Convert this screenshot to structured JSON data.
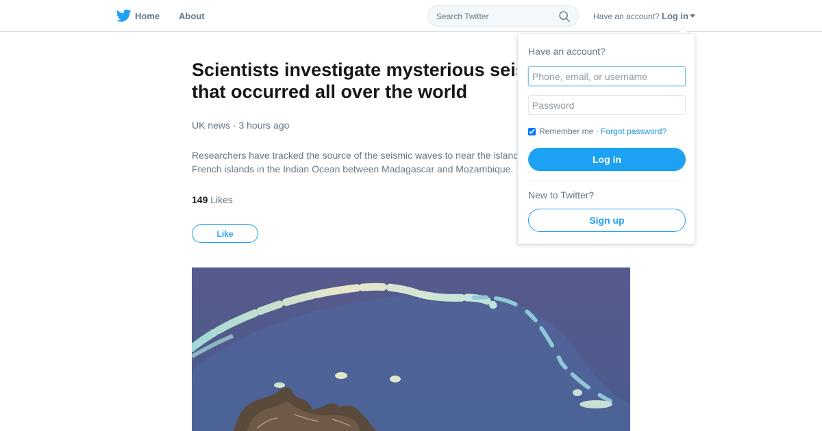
{
  "header": {
    "brand_icon": "bird-logo-icon",
    "home_label": "Home",
    "about_label": "About",
    "search_placeholder": "Search Twitter",
    "search_icon": "search-icon",
    "have_account": "Have an account?",
    "login_label": "Log in",
    "accent_color": "#1da1f2"
  },
  "article": {
    "headline": "Scientists investigate mysterious seismic waves that occurred all over the world",
    "meta": "UK news · 3 hours ago",
    "description": "Researchers have tracked the source of the seismic waves to near the island of Mayotte, one of the French islands in the Indian Ocean between Madagascar and Mozambique.",
    "likes_count": "149",
    "likes_label": "Likes",
    "like_button": "Like",
    "image_alt": "Satellite photo of an island and reef"
  },
  "login_dropdown": {
    "heading": "Have an account?",
    "username_placeholder": "Phone, email, or username",
    "password_placeholder": "Password",
    "remember_label": "Remember me",
    "separator": "·",
    "forgot_label": "Forgot password?",
    "login_button": "Log in",
    "new_to": "New to Twitter?",
    "signup_button": "Sign up"
  }
}
